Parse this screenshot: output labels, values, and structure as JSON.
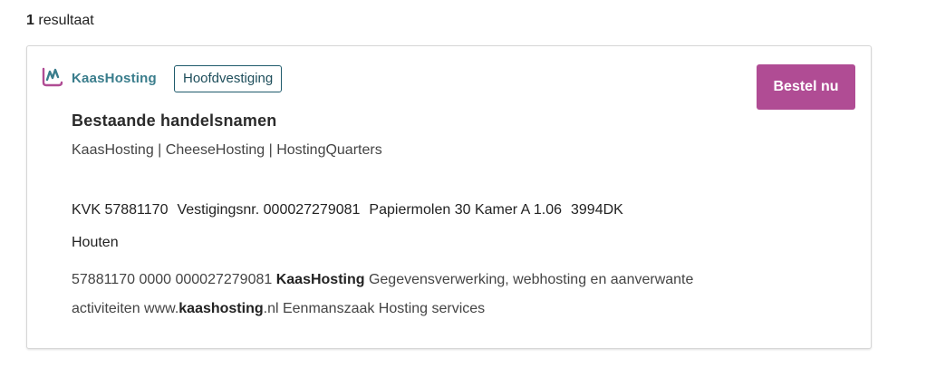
{
  "results": {
    "count": "1",
    "label": "resultaat"
  },
  "card": {
    "logo_text": "KaasHosting",
    "badge": "Hoofdvestiging",
    "order_button": "Bestel nu",
    "section_heading": "Bestaande handelsnamen",
    "trade_names": "KaasHosting | CheeseHosting | HostingQuarters",
    "address": {
      "kvk": "KVK 57881170",
      "branch_number": "Vestigingsnr. 000027279081",
      "street": "Papiermolen 30 Kamer A 1.06",
      "postcode": "3994DK",
      "city": "Houten"
    },
    "description": {
      "prefix": "57881170 0000 000027279081 ",
      "highlight_name": "KaasHosting",
      "middle": " Gegevensverwerking, webhosting en aanverwante activiteiten www.",
      "highlight_domain": "kaashosting",
      "suffix": ".nl Eenmanszaak Hosting services"
    }
  },
  "colors": {
    "accent": "#b04c94",
    "logo_teal": "#3a7d8c",
    "badge_border": "#1e5a6b"
  },
  "icons": {
    "logo": "kaashosting-logo-icon"
  }
}
